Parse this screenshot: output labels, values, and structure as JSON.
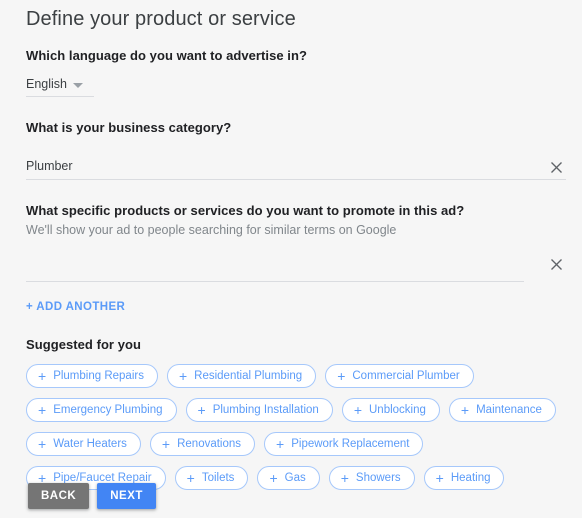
{
  "page": {
    "title": "Define your product or service"
  },
  "language": {
    "question": "Which language do you want to advertise in?",
    "selected": "English",
    "caret_icon": "chevron-down-icon"
  },
  "business_category": {
    "question": "What is your business category?",
    "value": "Plumber",
    "placeholder": "",
    "clear_icon": "close-icon"
  },
  "products": {
    "question": "What specific products or services do you want to promote in this ad?",
    "help": "We'll show your ad to people searching for similar terms on Google",
    "value": "",
    "placeholder": "",
    "clear_icon": "close-icon",
    "add_another_label": "+ ADD ANOTHER"
  },
  "suggested": {
    "heading": "Suggested for you",
    "add_icon": "plus-icon",
    "chips": [
      "Plumbing Repairs",
      "Residential Plumbing",
      "Commercial Plumber",
      "Emergency Plumbing",
      "Plumbing Installation",
      "Unblocking",
      "Maintenance",
      "Water Heaters",
      "Renovations",
      "Pipework Replacement",
      "Pipe/Faucet Repair",
      "Toilets",
      "Gas",
      "Showers",
      "Heating"
    ]
  },
  "footer": {
    "back_label": "BACK",
    "next_label": "NEXT"
  },
  "colors": {
    "accent_blue": "#4285f4",
    "chip_blue": "#5b9bf8",
    "chip_border": "#a6c8fb",
    "back_gray": "#757575",
    "background": "#f6f6f6",
    "text_primary": "#202124",
    "text_secondary": "#80868b"
  }
}
